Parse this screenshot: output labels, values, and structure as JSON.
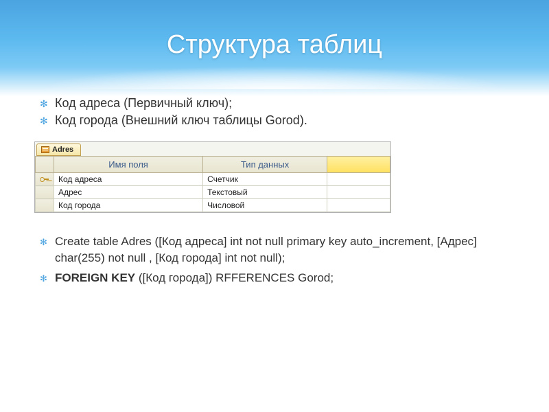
{
  "title": "Структура таблиц",
  "top_bullets": [
    "Код адреса (Первичный ключ);",
    "Код города (Внешний ключ таблицы Gorod)."
  ],
  "table": {
    "tab_name": "Adres",
    "headers": {
      "field": "Имя поля",
      "type": "Тип данных"
    },
    "rows": [
      {
        "key": true,
        "field": "Код адреса",
        "type": "Счетчик"
      },
      {
        "key": false,
        "field": "Адрес",
        "type": "Текстовый"
      },
      {
        "key": false,
        "field": "Код города",
        "type": "Числовой"
      }
    ]
  },
  "sql": {
    "create": "Create table Adres ([Код адреса] int not null primary key auto_increment, [Адрес] char(255) not null , [Код города] int  not null);",
    "fk_keyword": "FOREIGN KEY",
    "fk_rest": " ([Код города]) RFFERENCES Gorod;"
  }
}
